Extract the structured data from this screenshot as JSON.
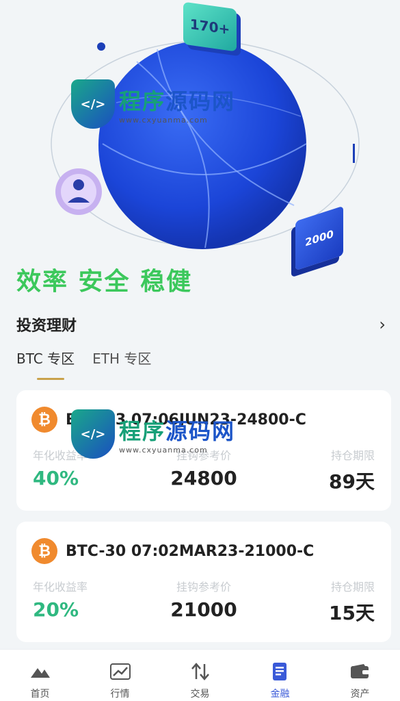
{
  "hero": {
    "badge_top": "170+",
    "badge_right": "2000",
    "slogan": "效率 安全 稳健"
  },
  "watermark": {
    "title_part1": "程序",
    "title_part2": "源码网",
    "url": "www.cxyuanma.com"
  },
  "section": {
    "title": "投资理财",
    "tabs": [
      {
        "label": "BTC 专区",
        "active": true
      },
      {
        "label": "ETH 专区",
        "active": false
      }
    ]
  },
  "products": [
    {
      "name": "BTC-13 07:06JUN23-24800-C",
      "labels": {
        "rate": "年化收益率",
        "ref": "挂钩参考价",
        "period": "持仓期限"
      },
      "rate": "40%",
      "ref_price": "24800",
      "period": "89天"
    },
    {
      "name": "BTC-30 07:02MAR23-21000-C",
      "labels": {
        "rate": "年化收益率",
        "ref": "挂钩参考价",
        "period": "持仓期限"
      },
      "rate": "20%",
      "ref_price": "21000",
      "period": "15天"
    }
  ],
  "nav": [
    {
      "label": "首页",
      "icon": "home-mountain-icon",
      "active": false
    },
    {
      "label": "行情",
      "icon": "chart-icon",
      "active": false
    },
    {
      "label": "交易",
      "icon": "swap-arrows-icon",
      "active": false
    },
    {
      "label": "金融",
      "icon": "document-icon",
      "active": true
    },
    {
      "label": "资产",
      "icon": "wallet-icon",
      "active": false
    }
  ],
  "colors": {
    "accent_green": "#3cc85c",
    "rate_green": "#2fb880",
    "active_blue": "#3a5ad8",
    "tab_underline": "#c9a24b",
    "coin_orange": "#f08a2e"
  }
}
